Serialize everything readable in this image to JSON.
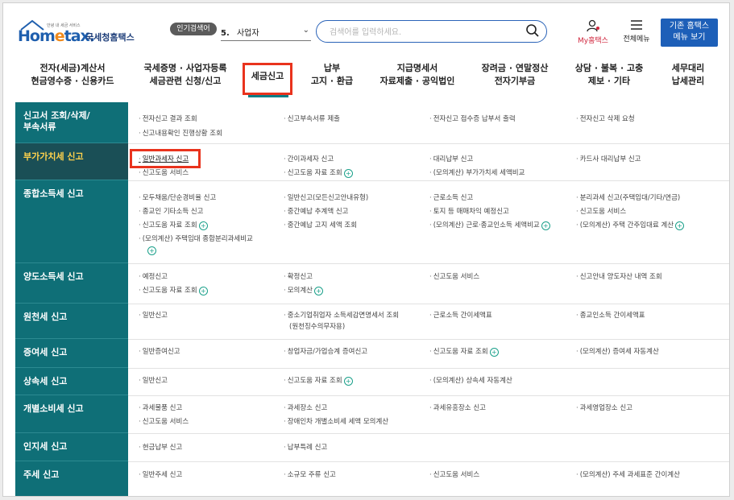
{
  "header": {
    "logo_small": "안녕 내 세금 서비스",
    "logo_mark_a": "Hom",
    "logo_mark_b": "e",
    "logo_mark_c": "tax.",
    "logo_name": "국세청홈택스",
    "popular_label": "인기검색어",
    "rank_num": "5.",
    "rank_text": "사업자",
    "search_placeholder": "검색어를 입력하세요.",
    "myhome": "My홈택스",
    "allmenu": "전체메뉴",
    "basic_btn_1": "기존 홈택스",
    "basic_btn_2": "메뉴 보기"
  },
  "gnb": [
    {
      "l1": "전자(세금)계산서",
      "l2": "현금영수증 · 신용카드"
    },
    {
      "l1": "국세증명 · 사업자등록",
      "l2": "세금관련 신청/신고"
    },
    {
      "l1": "세금신고",
      "l2": ""
    },
    {
      "l1": "납부",
      "l2": "고지 · 환급"
    },
    {
      "l1": "지급명세서",
      "l2": "자료제출 · 공익법인"
    },
    {
      "l1": "장려금 · 연말정산",
      "l2": "전자기부금"
    },
    {
      "l1": "상담 · 불복 · 고충",
      "l2": "제보 · 기타"
    },
    {
      "l1": "세무대리",
      "l2": "납세관리"
    }
  ],
  "rows": [
    {
      "side1": "신고서 조회/삭제/",
      "side2": "부속서류",
      "items": [
        "전자신고 결과 조회",
        "신고부속서류 제출",
        "전자신고 접수증 납부서 출력",
        "전자신고 삭제 요청",
        "신고내용확인 진행상황 조회"
      ]
    },
    {
      "side1": "부가가치세 신고",
      "side2": "",
      "items": [
        "일반과세자 신고",
        "간이과세자 신고",
        "대리납부 신고",
        "카드사 대리납부 신고",
        "신고도움 서비스",
        "신고도움 자료 조회",
        "(모의계산) 부가가치세 세액비교"
      ]
    },
    {
      "side1": "종합소득세 신고",
      "side2": "",
      "items": [
        "모두채움/단순경비율 신고",
        "일반신고(모든신고안내유형)",
        "근로소득 신고",
        "분리과세 신고(주택임대/기타/연금)",
        "종교인 기타소득 신고",
        "중간예납 추계액 신고",
        "토지 등 매매차익 예정신고",
        "신고도움 서비스",
        "신고도움 자료 조회",
        "중간예납 고지 세액 조회",
        "(모의계산) 근로·종교인소득 세액비교",
        "(모의계산) 주택 간주임대료 계산",
        "(모의계산) 주택임대 종합분리과세비교"
      ]
    },
    {
      "side1": "양도소득세 신고",
      "side2": "",
      "items": [
        "예정신고",
        "확정신고",
        "신고도움 서비스",
        "신고안내 양도자산 내역 조회",
        "신고도움 자료 조회",
        "모의계산"
      ]
    },
    {
      "side1": "원천세 신고",
      "side2": "",
      "items": [
        "일반신고",
        "중소기업취업자 소득세감면명세서 조회",
        "(원천징수의무자용)",
        "근로소득 간이세액표",
        "종교인소득 간이세액표"
      ]
    },
    {
      "side1": "증여세 신고",
      "side2": "",
      "items": [
        "일반증여신고",
        "창업자금/가업승계 증여신고",
        "신고도움 자료 조회",
        "(모의계산) 증여세 자동계산"
      ]
    },
    {
      "side1": "상속세 신고",
      "side2": "",
      "items": [
        "일반신고",
        "신고도움 자료 조회",
        "(모의계산) 상속세 자동계산"
      ]
    },
    {
      "side1": "개별소비세 신고",
      "side2": "",
      "items": [
        "과세물품 신고",
        "과세장소 신고",
        "과세유흥장소 신고",
        "과세영업장소 신고",
        "신고도움 서비스",
        "장애인차 개별소비세 세액 모의계산"
      ]
    },
    {
      "side1": "인지세 신고",
      "side2": "",
      "items": [
        "현금납부 신고",
        "납부특례 신고"
      ]
    },
    {
      "side1": "주세 신고",
      "side2": "",
      "items": [
        "일반주세 신고",
        "소규모 주류 신고",
        "신고도움 서비스",
        "(모의계산) 주세 과세표준 간이계산"
      ]
    }
  ]
}
